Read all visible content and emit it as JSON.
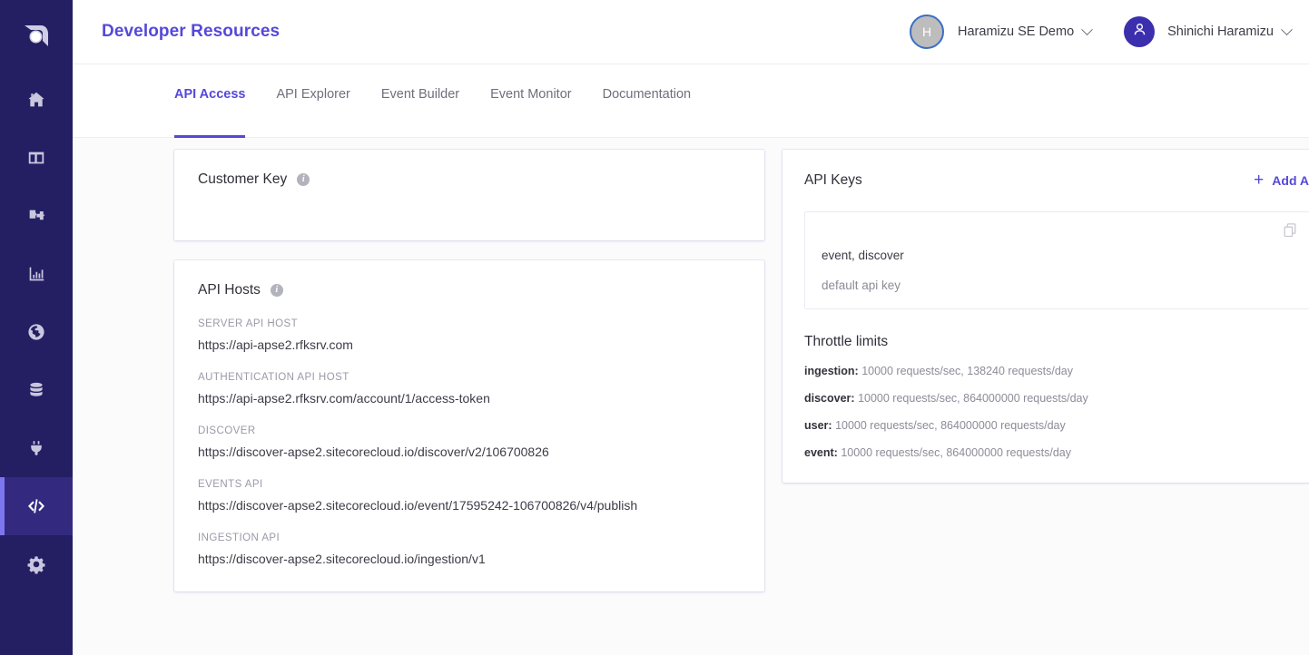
{
  "sidebar": {
    "logo": "sitecore-logo",
    "items": [
      {
        "icon": "home-icon",
        "name": "home",
        "active": false
      },
      {
        "icon": "layout-icon",
        "name": "pages",
        "active": false
      },
      {
        "icon": "puzzle-icon",
        "name": "components",
        "active": false
      },
      {
        "icon": "chart-bar-icon",
        "name": "analytics",
        "active": false
      },
      {
        "icon": "globe-icon",
        "name": "sites",
        "active": false
      },
      {
        "icon": "database-icon",
        "name": "content",
        "active": false
      },
      {
        "icon": "plug-icon",
        "name": "connections",
        "active": false
      },
      {
        "icon": "code-icon",
        "name": "developer-resources",
        "active": true
      },
      {
        "icon": "gear-icon",
        "name": "settings",
        "active": false
      }
    ],
    "bg_color": "#241e63",
    "active_bg_color": "#332a80",
    "active_bar_color": "#7d76f0"
  },
  "header": {
    "title": "Developer Resources",
    "title_color": "#5548d9",
    "tenant": {
      "avatar_initial": "H",
      "avatar_bg": "#bdbdbd",
      "avatar_ring": "#3b6fc4",
      "name": "Haramizu SE Demo"
    },
    "user": {
      "icon": "user-icon",
      "icon_bg": "#3c2fae",
      "name": "Shinichi Haramizu"
    }
  },
  "tabs": [
    {
      "label": "API Access",
      "active": true
    },
    {
      "label": "API Explorer",
      "active": false
    },
    {
      "label": "Event Builder",
      "active": false
    },
    {
      "label": "Event Monitor",
      "active": false
    },
    {
      "label": "Documentation",
      "active": false
    }
  ],
  "customer_key": {
    "title": "Customer Key",
    "info_icon": "info-icon",
    "value": ""
  },
  "api_hosts": {
    "title": "API Hosts",
    "info_icon": "info-icon",
    "rows": [
      {
        "label": "SERVER API HOST",
        "value": "https://api-apse2.rfksrv.com"
      },
      {
        "label": "AUTHENTICATION API HOST",
        "value": "https://api-apse2.rfksrv.com/account/1/access-token"
      },
      {
        "label": "DISCOVER",
        "value": "https://discover-apse2.sitecorecloud.io/discover/v2/106700826"
      },
      {
        "label": "EVENTS API",
        "value": "https://discover-apse2.sitecorecloud.io/event/17595242-106700826/v4/publish"
      },
      {
        "label": "INGESTION API",
        "value": "https://discover-apse2.sitecorecloud.io/ingestion/v1"
      }
    ]
  },
  "api_keys": {
    "title": "API Keys",
    "add_label": "Add Api Key",
    "add_icon": "plus-icon",
    "accent_color": "#5548d9",
    "items": [
      {
        "scopes": "event, discover",
        "description": "default api key",
        "copy_icon": "copy-icon",
        "delete_icon": "trash-icon"
      }
    ],
    "throttle": {
      "title": "Throttle limits",
      "rows": [
        {
          "key": "ingestion:",
          "value": "10000 requests/sec, 138240 requests/day"
        },
        {
          "key": "discover:",
          "value": "10000 requests/sec, 864000000 requests/day"
        },
        {
          "key": "user:",
          "value": "10000 requests/sec, 864000000 requests/day"
        },
        {
          "key": "event:",
          "value": "10000 requests/sec, 864000000 requests/day"
        }
      ]
    }
  }
}
